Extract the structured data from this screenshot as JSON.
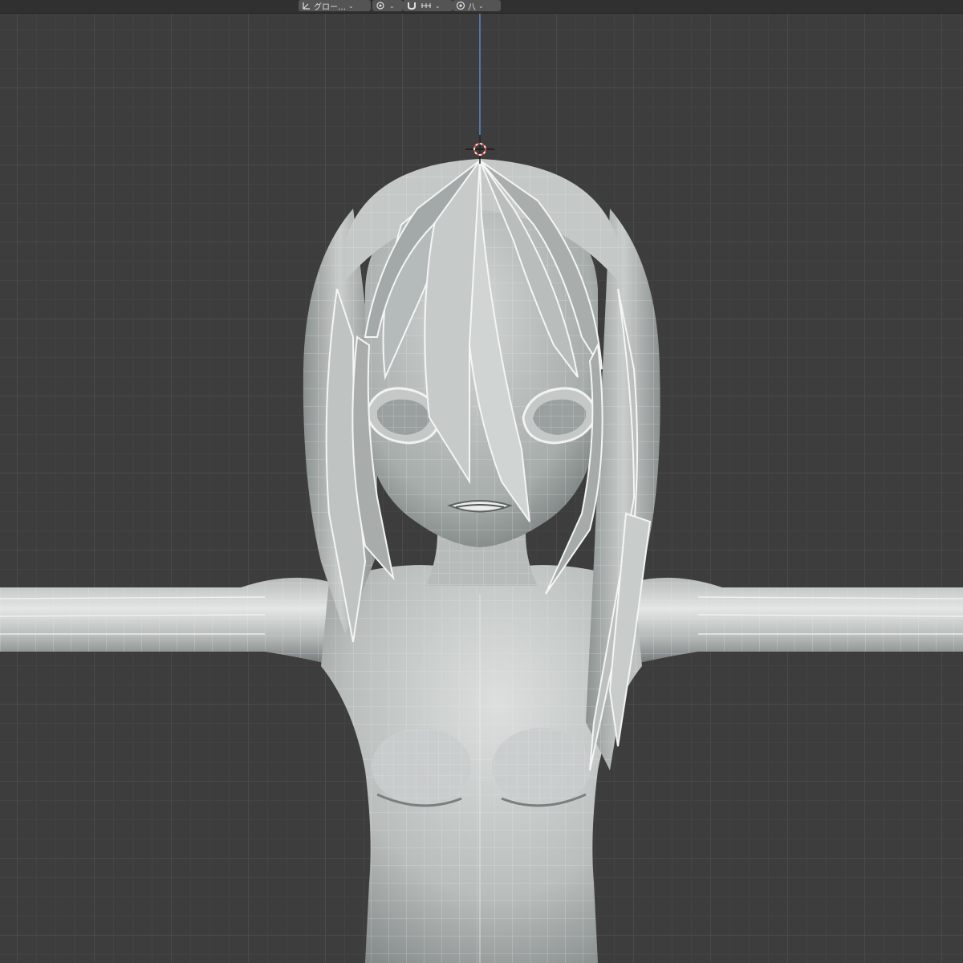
{
  "header": {
    "transform_orientation_label": "グロー…",
    "snap_icon": "snap-magnet-icon",
    "pivot_icon": "pivot-point-icon",
    "proportional_icon": "proportional-editing-icon",
    "falloff_label": "八"
  },
  "viewport": {
    "view": "front-orthographic",
    "object": "anime-character-base-mesh",
    "cursor_icon": "3d-cursor-icon"
  },
  "colors": {
    "background": "#3d3d3d",
    "grid_major": "#4a4a4a",
    "grid_minor": "#434343",
    "mesh_light": "#d6d9d8",
    "mesh_mid": "#a9aeac",
    "mesh_dark": "#6e7473",
    "wire": "#f2f2f2",
    "z_axis": "#5b85c8"
  }
}
